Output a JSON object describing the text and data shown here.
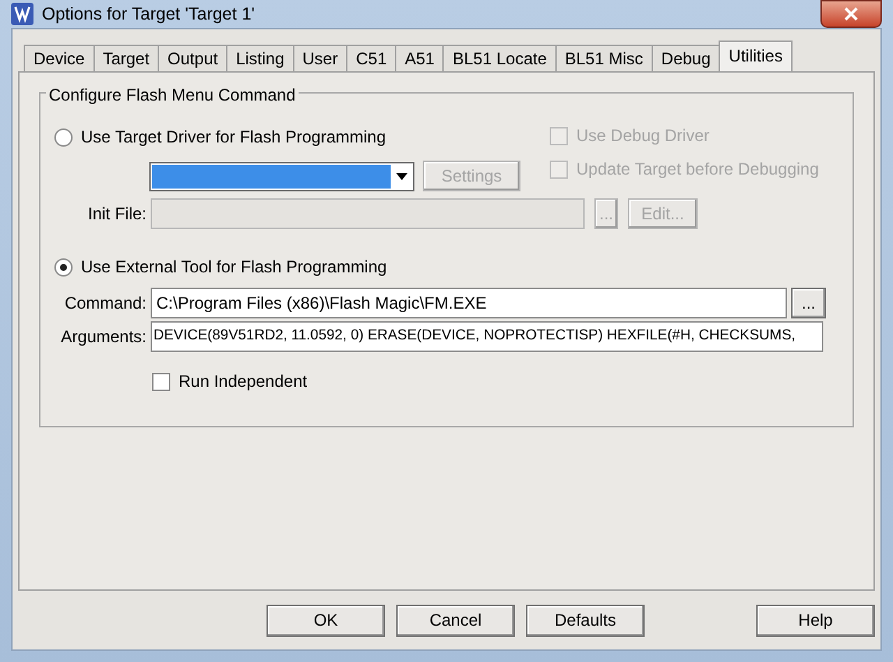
{
  "window": {
    "title": "Options for Target 'Target 1'"
  },
  "tabs": [
    {
      "label": "Device",
      "selected": false
    },
    {
      "label": "Target",
      "selected": false
    },
    {
      "label": "Output",
      "selected": false
    },
    {
      "label": "Listing",
      "selected": false
    },
    {
      "label": "User",
      "selected": false
    },
    {
      "label": "C51",
      "selected": false
    },
    {
      "label": "A51",
      "selected": false
    },
    {
      "label": "BL51 Locate",
      "selected": false
    },
    {
      "label": "BL51 Misc",
      "selected": false
    },
    {
      "label": "Debug",
      "selected": false
    },
    {
      "label": "Utilities",
      "selected": true
    }
  ],
  "group": {
    "title": "Configure Flash Menu Command",
    "target_driver": {
      "label": "Use Target Driver for Flash Programming",
      "selected": false,
      "settings_button": {
        "label": "Settings",
        "disabled": true
      },
      "init_file": {
        "label": "Init File:",
        "disabled": true
      },
      "browse_button": {
        "label": "...",
        "disabled": true
      },
      "edit_button": {
        "label": "Edit...",
        "disabled": true
      }
    },
    "checkboxes": [
      {
        "label": "Use Debug Driver",
        "checked": false,
        "disabled": true
      },
      {
        "label": "Update Target before Debugging",
        "checked": false,
        "disabled": true
      }
    ],
    "external_tool": {
      "label": "Use External Tool for Flash Programming",
      "selected": true,
      "command": {
        "label": "Command:",
        "value": "C:\\Program Files (x86)\\Flash Magic\\FM.EXE"
      },
      "browse_button": {
        "label": "...",
        "disabled": false
      },
      "arguments": {
        "label": "Arguments:",
        "value": "DEVICE(89V51RD2, 11.0592, 0) ERASE(DEVICE, NOPROTECTISP) HEXFILE(#H, CHECKSUMS,"
      },
      "run_independent": {
        "label": "Run Independent",
        "checked": false
      }
    }
  },
  "buttons": [
    {
      "label": "OK"
    },
    {
      "label": "Cancel"
    },
    {
      "label": "Defaults"
    },
    {
      "label": "Help"
    }
  ]
}
